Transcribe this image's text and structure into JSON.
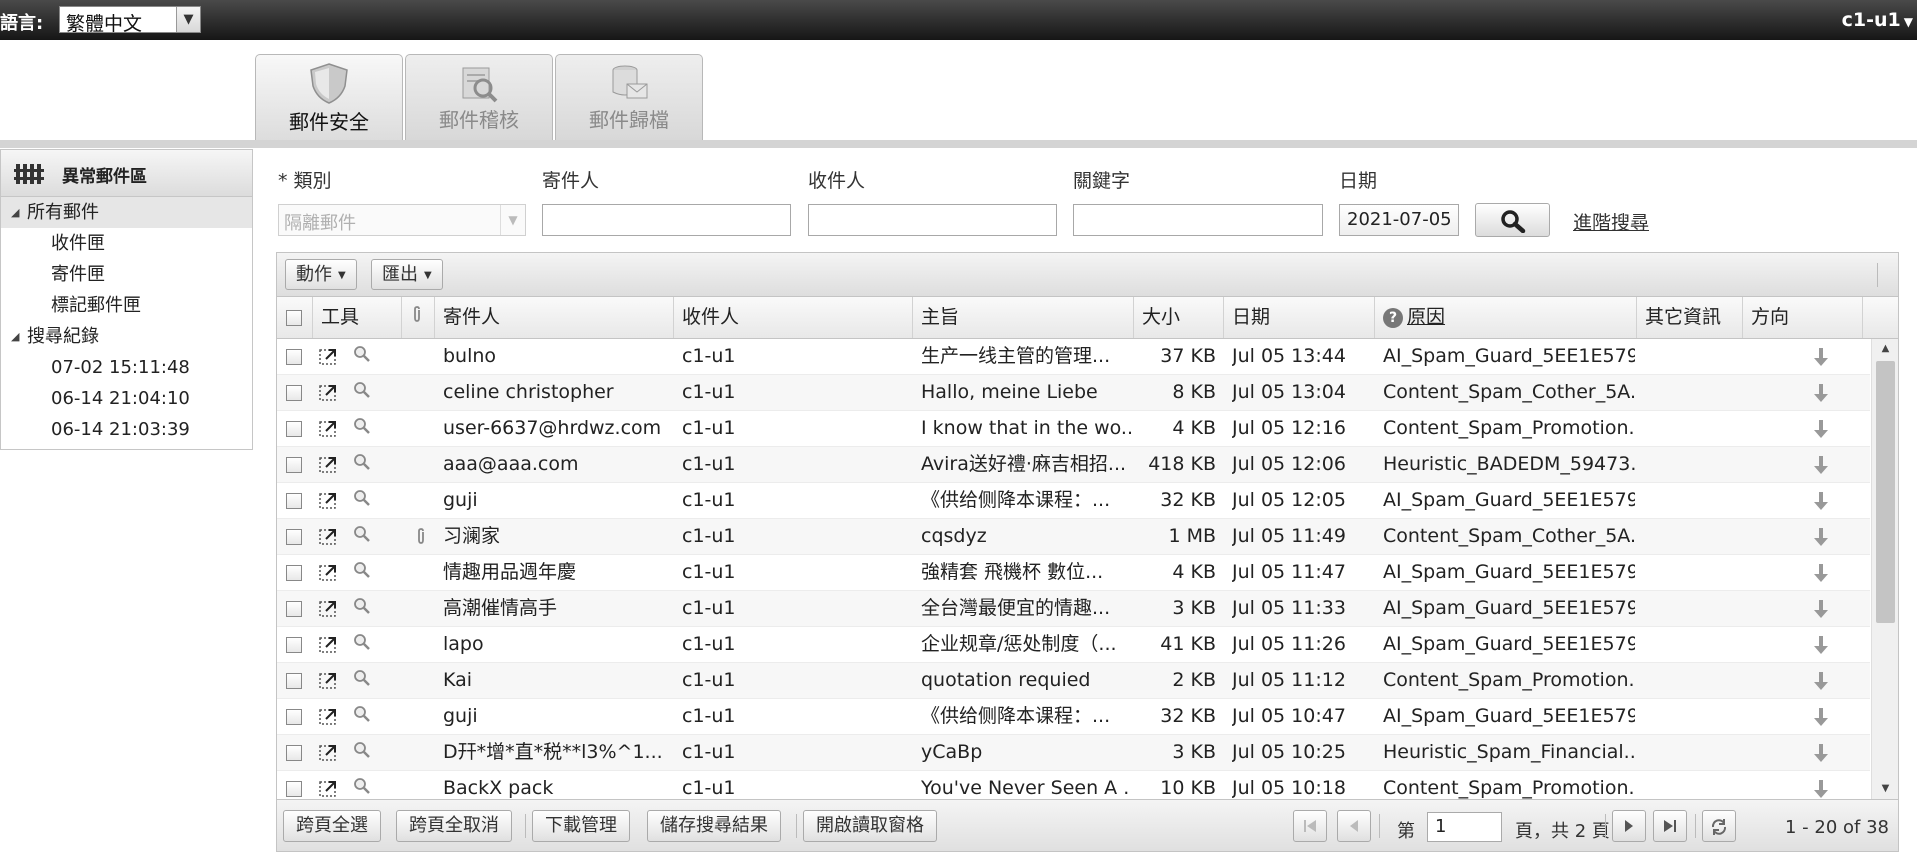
{
  "topbar": {
    "language_label": "語言:",
    "language_value": "繁體中文",
    "user": "c1-u1"
  },
  "modules": [
    {
      "label": "郵件安全",
      "active": true
    },
    {
      "label": "郵件稽核",
      "active": false
    },
    {
      "label": "郵件歸檔",
      "active": false
    }
  ],
  "sidebar": {
    "title": "異常郵件區",
    "all_mail": "所有郵件",
    "folders": [
      "收件匣",
      "寄件匣",
      "標記郵件匣"
    ],
    "search_history": "搜尋紀錄",
    "history": [
      "07-02 15:11:48",
      "06-14 21:04:10",
      "06-14 21:03:39"
    ]
  },
  "filters": {
    "category_label": "* 類別",
    "category_value": "隔離郵件",
    "sender_label": "寄件人",
    "recipient_label": "收件人",
    "keyword_label": "關鍵字",
    "date_label": "日期",
    "date_value": "2021-07-05",
    "advanced_search": "進階搜尋"
  },
  "toolbar": {
    "actions": "動作",
    "export": "匯出"
  },
  "columns": {
    "tools": "工具",
    "sender": "寄件人",
    "recipient": "收件人",
    "subject": "主旨",
    "size": "大小",
    "date": "日期",
    "reason": "原因",
    "other": "其它資訊",
    "direction": "方向"
  },
  "rows": [
    {
      "sender": "bulno",
      "recipient": "c1-u1",
      "subject": "生产一线主管的管理...",
      "size": "37 KB",
      "date": "Jul 05 13:44",
      "reason": "AI_Spam_Guard_5EE1E579",
      "attachment": false
    },
    {
      "sender": "celine christopher",
      "recipient": "c1-u1",
      "subject": "Hallo, meine Liebe",
      "size": "8 KB",
      "date": "Jul 05 13:04",
      "reason": "Content_Spam_Cother_5A...",
      "attachment": false
    },
    {
      "sender": "user-6637@hrdwz.com",
      "recipient": "c1-u1",
      "subject": "I know that in the wo...",
      "size": "4 KB",
      "date": "Jul 05 12:16",
      "reason": "Content_Spam_Promotion...",
      "attachment": false
    },
    {
      "sender": "aaa@aaa.com",
      "recipient": "c1-u1",
      "subject": "Avira送好禮‧麻吉相招...",
      "size": "418 KB",
      "date": "Jul 05 12:06",
      "reason": "Heuristic_BADEDM_59473...",
      "attachment": false
    },
    {
      "sender": "guji",
      "recipient": "c1-u1",
      "subject": "《供给侧降本课程：...",
      "size": "32 KB",
      "date": "Jul 05 12:05",
      "reason": "AI_Spam_Guard_5EE1E579",
      "attachment": false
    },
    {
      "sender": "习澜家",
      "recipient": "c1-u1",
      "subject": "cqsdyz",
      "size": "1 MB",
      "date": "Jul 05 11:49",
      "reason": "Content_Spam_Cother_5A...",
      "attachment": true
    },
    {
      "sender": "情趣用品週年慶",
      "recipient": "c1-u1",
      "subject": "強精套 飛機杯 數位...",
      "size": "4 KB",
      "date": "Jul 05 11:47",
      "reason": "AI_Spam_Guard_5EE1E579",
      "attachment": false
    },
    {
      "sender": "高潮催情高手",
      "recipient": "c1-u1",
      "subject": "全台灣最便宜的情趣...",
      "size": "3 KB",
      "date": "Jul 05 11:33",
      "reason": "AI_Spam_Guard_5EE1E579",
      "attachment": false
    },
    {
      "sender": "lapo",
      "recipient": "c1-u1",
      "subject": "企业规章/惩处制度（...",
      "size": "41 KB",
      "date": "Jul 05 11:26",
      "reason": "AI_Spam_Guard_5EE1E579",
      "attachment": false
    },
    {
      "sender": "Kai",
      "recipient": "c1-u1",
      "subject": "quotation requied",
      "size": "2 KB",
      "date": "Jul 05 11:12",
      "reason": "Content_Spam_Promotion...",
      "attachment": false
    },
    {
      "sender": "guji",
      "recipient": "c1-u1",
      "subject": "《供给侧降本课程：...",
      "size": "32 KB",
      "date": "Jul 05 10:47",
      "reason": "AI_Spam_Guard_5EE1E579",
      "attachment": false
    },
    {
      "sender": "D幵*增*直*税**l3%^1...",
      "recipient": "c1-u1",
      "subject": "yCaBp",
      "size": "3 KB",
      "date": "Jul 05 10:25",
      "reason": "Heuristic_Spam_Financial...",
      "attachment": false
    },
    {
      "sender": "BackX pack",
      "recipient": "c1-u1",
      "subject": "You've Never Seen A ...",
      "size": "10 KB",
      "date": "Jul 05 10:18",
      "reason": "Content_Spam_Promotion...",
      "attachment": false
    }
  ],
  "footer": {
    "select_all": "跨頁全選",
    "deselect_all": "跨頁全取消",
    "download_manager": "下載管理",
    "save_search": "儲存搜尋結果",
    "reading_pane": "開啟讀取窗格",
    "page_label": "第",
    "page_value": "1",
    "page_total": "頁，共 2 頁",
    "range": "1 - 20 of 38"
  },
  "colors": {
    "topbar": "#1e1e1e",
    "accent_bar": "#d4d4d4"
  }
}
